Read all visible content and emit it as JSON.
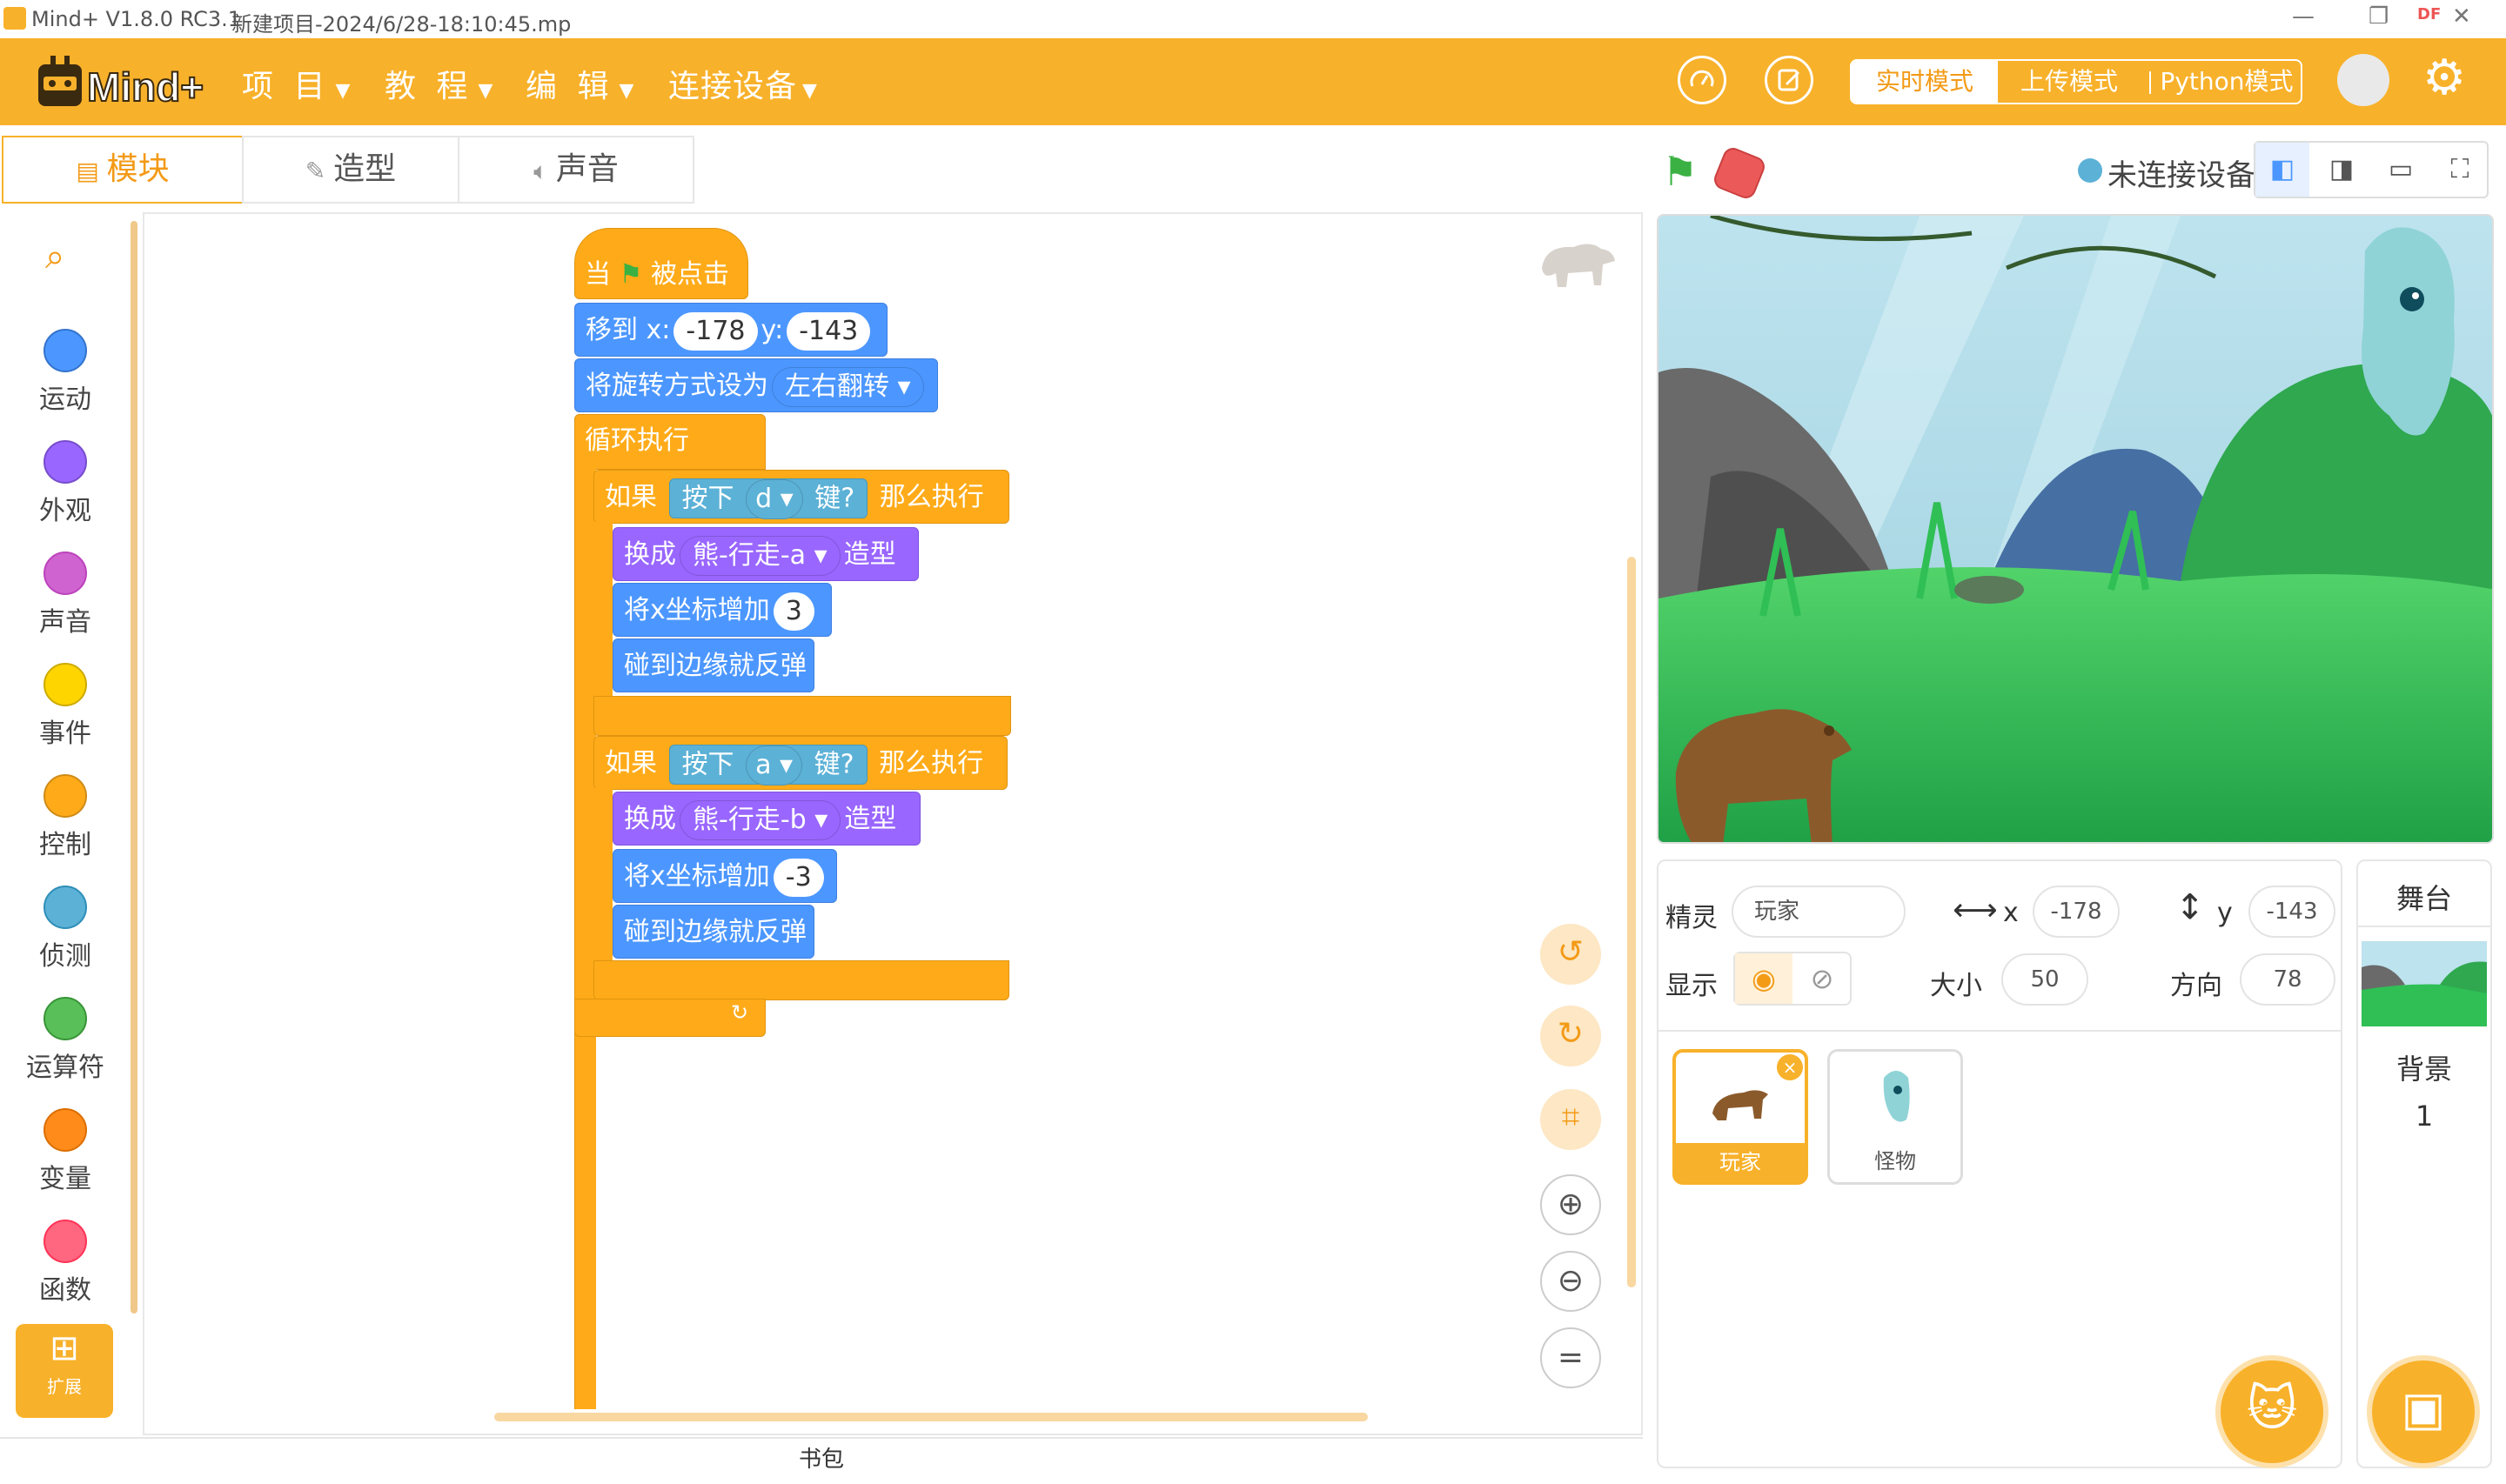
{
  "window": {
    "app_title": "Mind+ V1.8.0 RC3.1",
    "project_title": "新建项目-2024/6/28-18:10:45.mp",
    "badge": "DF"
  },
  "menubar": {
    "logo": "Mind+",
    "items": [
      "项 目",
      "教 程",
      "编 辑",
      "连接设备"
    ],
    "modes": [
      "实时模式",
      "上传模式",
      "Python模式"
    ],
    "active_mode": "实时模式"
  },
  "tabs": [
    "模块",
    "造型",
    "声音"
  ],
  "categories": [
    {
      "label": "运动",
      "color": "#4c97ff"
    },
    {
      "label": "外观",
      "color": "#9966ff"
    },
    {
      "label": "声音",
      "color": "#cf63cf"
    },
    {
      "label": "事件",
      "color": "#ffd500"
    },
    {
      "label": "控制",
      "color": "#ffab19"
    },
    {
      "label": "侦测",
      "color": "#5cb1d6"
    },
    {
      "label": "运算符",
      "color": "#59c059"
    },
    {
      "label": "变量",
      "color": "#ff8c1a"
    },
    {
      "label": "函数",
      "color": "#ff6680"
    }
  ],
  "extension_label": "扩展",
  "script": {
    "hat_when": "当",
    "hat_clicked": "被点击",
    "goto_label": "移到 x:",
    "goto_x": "-178",
    "goto_y_label": "y:",
    "goto_y": "-143",
    "rotation_label": "将旋转方式设为",
    "rotation_value": "左右翻转",
    "forever_label": "循环执行",
    "if1_label": "如果",
    "key_pressed_pre": "按下",
    "key1": "d",
    "key_pressed_post": "键?",
    "then_label": "那么执行",
    "switch_costume_pre": "换成",
    "costume1": "熊-行走-a",
    "switch_costume_post": "造型",
    "change_x_label": "将x坐标增加",
    "change_x1": "3",
    "bounce_label": "碰到边缘就反弹",
    "key2": "a",
    "costume2": "熊-行走-b",
    "change_x2": "-3"
  },
  "stage_head": {
    "device_status": "未连接设备"
  },
  "sprite_info": {
    "sprite_label": "精灵",
    "sprite_name": "玩家",
    "x_label": "x",
    "x_value": "-178",
    "y_label": "y",
    "y_value": "-143",
    "show_label": "显示",
    "size_label": "大小",
    "size_value": "50",
    "direction_label": "方向",
    "direction_value": "78"
  },
  "sprites": [
    {
      "name": "玩家",
      "selected": true
    },
    {
      "name": "怪物",
      "selected": false
    }
  ],
  "stage_panel": {
    "title": "舞台",
    "backdrop_label": "背景",
    "backdrop_count": "1"
  },
  "bottom_bar": {
    "label": "书包"
  },
  "colors": {
    "accent": "#f8b12a",
    "motion": "#4c97ff",
    "looks": "#9966ff",
    "control": "#ffab19",
    "sensing": "#5cb1d6"
  }
}
